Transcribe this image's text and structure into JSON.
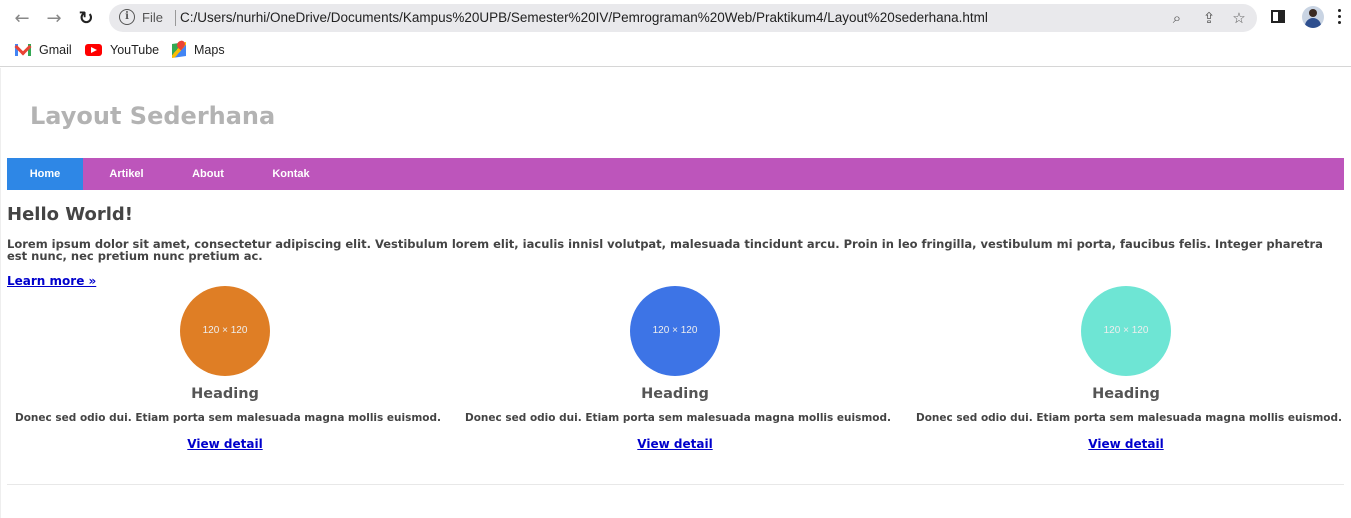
{
  "browser": {
    "file_label": "File",
    "url": "C:/Users/nurhi/OneDrive/Documents/Kampus%20UPB/Semester%20IV/Pemrograman%20Web/Praktikum4/Layout%20sederhana.html"
  },
  "bookmarks": [
    {
      "label": "Gmail",
      "icon": "gmail-icon"
    },
    {
      "label": "YouTube",
      "icon": "youtube-icon"
    },
    {
      "label": "Maps",
      "icon": "maps-icon"
    }
  ],
  "site": {
    "title": "Layout Sederhana",
    "nav": [
      {
        "label": "Home",
        "active": true
      },
      {
        "label": "Artikel",
        "active": false
      },
      {
        "label": "About",
        "active": false
      },
      {
        "label": "Kontak",
        "active": false
      }
    ]
  },
  "hero": {
    "heading": "Hello World!",
    "text": "Lorem ipsum dolor sit amet, consectetur adipiscing elit. Vestibulum lorem elit, iaculis innisl volutpat, malesuada tincidunt arcu. Proin in leo fringilla, vestibulum mi porta, faucibus felis. Integer pharetra est nunc, nec pretium nunc pretium ac.",
    "link": "Learn more »"
  },
  "columns": [
    {
      "placeholder": "120 × 120",
      "heading": "Heading",
      "text": "Donec sed odio dui. Etiam porta sem malesuada magna mollis euismod.",
      "link": "View detail",
      "color": "#df7e25"
    },
    {
      "placeholder": "120 × 120",
      "heading": "Heading",
      "text": "Donec sed odio dui. Etiam porta sem malesuada magna mollis euismod.",
      "link": "View detail",
      "color": "#3d74e6"
    },
    {
      "placeholder": "120 × 120",
      "heading": "Heading",
      "text": "Donec sed odio dui. Etiam porta sem malesuada magna mollis euismod.",
      "link": "View detail",
      "color": "#6ee5d4"
    }
  ],
  "colors": {
    "navbar": "#bd55bb",
    "nav_active": "#2e87e6",
    "title": "#b3b3b3"
  }
}
